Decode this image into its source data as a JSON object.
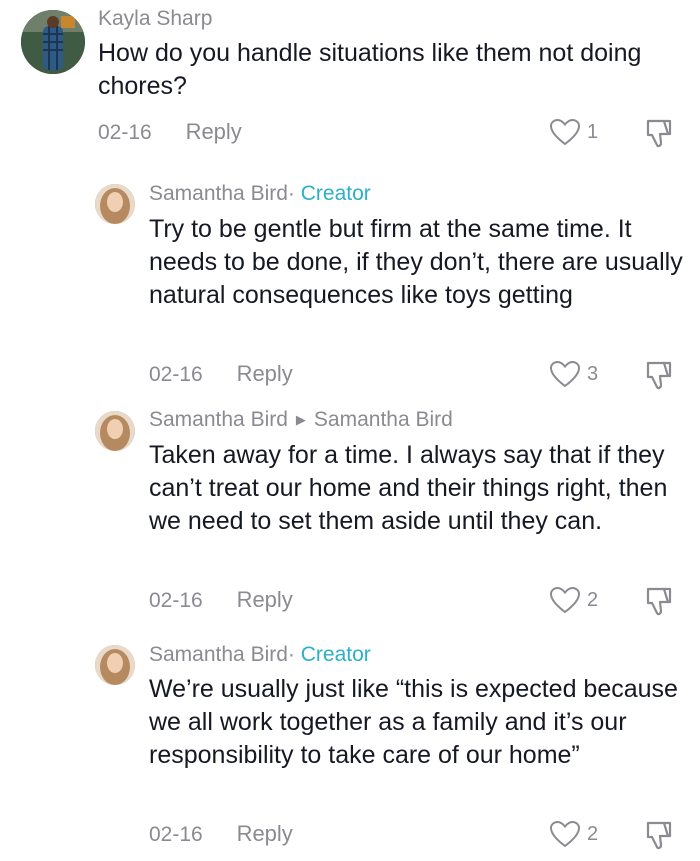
{
  "comments": [
    {
      "author": "Kayla Sharp",
      "creator_badge": "",
      "body": "How do you handle situations like them not doing chores?",
      "date": "02-16",
      "reply_label": "Reply",
      "likes": "1"
    },
    {
      "author": "Samantha Bird",
      "separator": "·",
      "creator_badge": "Creator",
      "body": "Try to be gentle but firm at the same time. It needs to be done, if they don’t, there are usually natural consequences like toys getting",
      "date": "02-16",
      "reply_label": "Reply",
      "likes": "3"
    },
    {
      "author": "Samantha Bird",
      "reply_to": "Samantha Bird",
      "body": "Taken away for a time. I always say that if they can’t treat our home and their things right, then we need to set them aside until they can.",
      "date": "02-16",
      "reply_label": "Reply",
      "likes": "2"
    },
    {
      "author": "Samantha Bird",
      "separator": "·",
      "creator_badge": "Creator",
      "body": "We’re usually just like “this is expected because we all work together as a family and it’s our responsibility to take care of our home”",
      "date": "02-16",
      "reply_label": "Reply",
      "likes": "2"
    }
  ],
  "icons": {
    "like": "heart-outline-icon",
    "dislike": "thumbs-down-outline-icon"
  }
}
